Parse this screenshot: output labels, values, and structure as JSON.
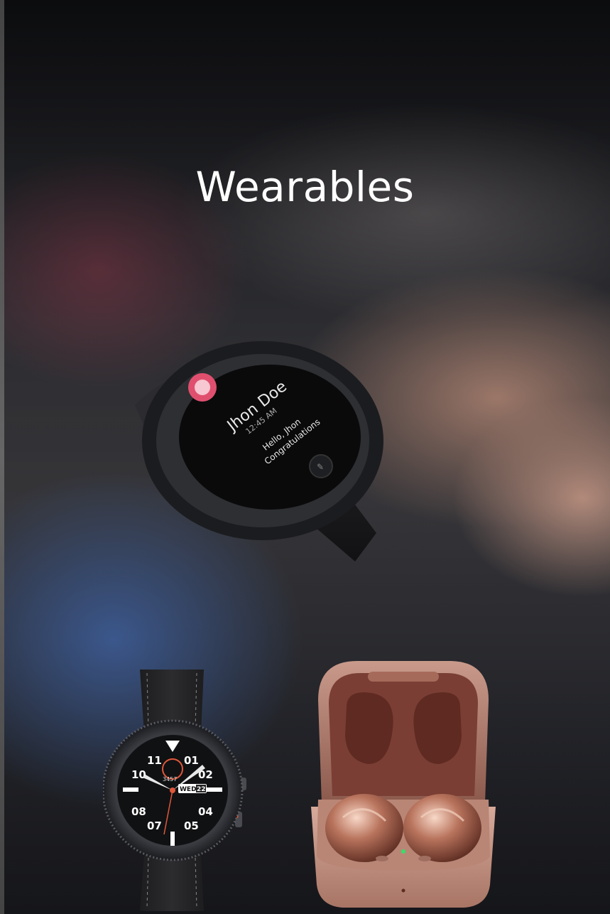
{
  "page": {
    "title": "Wearables"
  },
  "background_watch": {
    "contact_name": "Jhon Doe",
    "time": "12:45 AM",
    "message_line1": "Hello, Jhon",
    "message_line2": "Congratulations"
  },
  "watch_product": {
    "hours": [
      "11",
      "01",
      "10",
      "02",
      "08",
      "04",
      "07",
      "05"
    ],
    "step_count": "3457",
    "day": "WED",
    "date": "22"
  },
  "colors": {
    "title": "#ffffff",
    "buds_case": "#b88778",
    "buds_inner": "#7a3e34",
    "watch_body": "#2a2b2f",
    "watch_accent": "#e0573a"
  },
  "icons": [
    "watch-notification-avatar-icon",
    "watch-notification-reply-icon",
    "buds-led-icon"
  ]
}
